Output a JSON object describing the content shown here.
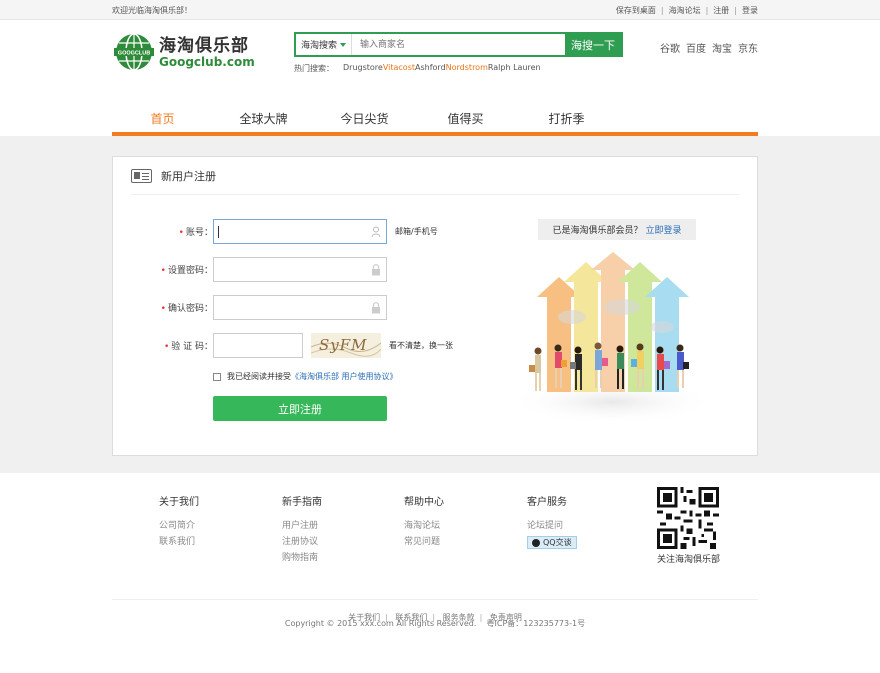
{
  "topbar": {
    "welcome": "欢迎光临海淘俱乐部！",
    "links": [
      "保存到桌面",
      "海淘论坛",
      "注册",
      "登录"
    ]
  },
  "logo": {
    "badge": "GOOGCLUB",
    "title": "海淘俱乐部",
    "domain": "Googclub.com"
  },
  "search": {
    "type_label": "海淘搜索",
    "placeholder": "输入商家名",
    "button": "海搜一下",
    "hot_label": "热门搜索：",
    "hot": [
      "Drugstore",
      "Vitacost",
      "Ashford",
      "Nordstrom",
      "Ralph Lauren"
    ]
  },
  "engines": [
    "谷歌",
    "百度",
    "淘宝",
    "京东"
  ],
  "nav": [
    "首页",
    "全球大牌",
    "今日尖货",
    "值得买",
    "打折季"
  ],
  "panel": {
    "title": "新用户注册"
  },
  "form": {
    "account_label": "账号：",
    "account_hint": "邮箱/手机号",
    "password_label": "设置密码：",
    "confirm_label": "确认密码：",
    "code_label": "验 证 码：",
    "captcha_text": "SyFM",
    "captcha_hint": "看不清楚，换一张",
    "agree_prefix": "我已经阅读并接受",
    "agree_link": "《海淘俱乐部 用户使用协议》",
    "submit": "立即注册"
  },
  "member": {
    "text": "已是海淘俱乐部会员？",
    "link": "立即登录"
  },
  "footer": {
    "cols": [
      {
        "title": "关于我们",
        "items": [
          "公司简介",
          "联系我们"
        ]
      },
      {
        "title": "新手指南",
        "items": [
          "用户注册",
          "注册协议",
          "购物指南"
        ]
      },
      {
        "title": "帮助中心",
        "items": [
          "海淘论坛",
          "常见问题"
        ]
      },
      {
        "title": "客户服务",
        "items": [
          "论坛提问"
        ],
        "qq": "QQ交谈"
      }
    ],
    "qr_caption": "关注海淘俱乐部",
    "links": [
      "关于我们",
      "联系我们",
      "服务条款",
      "免责声明"
    ],
    "copyright": "Copyright © 2015 xxx.com All Rights Reserved.    粤ICP备：123235773-1号"
  },
  "colors": {
    "brand_green": "#2f9e52",
    "nav_orange": "#f27c1f",
    "button_green": "#36b85a",
    "link_blue": "#2a6db5"
  }
}
